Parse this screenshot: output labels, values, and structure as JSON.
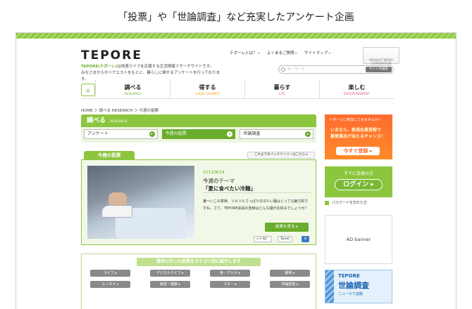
{
  "caption": "「投票」や「世論調査」など充実したアンケート企画",
  "site": {
    "logo": "TEPORE",
    "tagline_brand": "TEPORE(テポーレ)",
    "tagline_rest": "は快適ライフを応援する生活情報リサーチサイトです。",
    "tagline_line2": "みなさまからのリクエストをもとに、暮らしに関するアンケートを行っております。",
    "corp_label": "PRODUCT MEDIA CORPORATION"
  },
  "toplinks": [
    "テポーレとは？",
    "よくあるご質問",
    "サイトマップ"
  ],
  "search": {
    "placeholder": "キーワード",
    "button": "サイト内検索"
  },
  "gnav": [
    {
      "jp": "調べる",
      "en": "RESEARCH",
      "color": "#6aac2e"
    },
    {
      "jp": "得する",
      "en": "LUCKY CHANCE",
      "color": "#f39800"
    },
    {
      "jp": "暮らす",
      "en": "LIFE",
      "color": "#e85298"
    },
    {
      "jp": "楽しむ",
      "en": "ENTERTAINMENT",
      "color": "#e85298"
    }
  ],
  "breadcrumb": "HOME ＞ 調べる RESEARCH ＞ 今週の投票",
  "section": {
    "title": "調べる",
    "en": "RESEARCH"
  },
  "subtabs": [
    "アンケート",
    "今週の投票",
    "世論調査"
  ],
  "weekly": {
    "tab": "今週の投票",
    "backnumber": "これまでのバックナンバーはこちら ▸",
    "date": "2012/8/14",
    "theme_label": "今週のテーマ",
    "theme": "「夏に食べたい冷麺」",
    "desc": "暑～いこの季節、ツルツルさっぱりの冷たい麺はとっても魅力的ですね。さて、TEPORE会員の皆様はどんな麺がお好みでしょうか？",
    "result_button": "結果を見る ▸",
    "social": [
      "いいね！",
      "Tweet"
    ]
  },
  "categories": {
    "title": "過去に行った投票をカテゴリ別に紹介します",
    "items": [
      "ライフ ▸",
      "デジタルライフ ▸",
      "食・グルメ ▸",
      "趣味 ▸",
      "エンタメ ▸",
      "美容・健康 ▸",
      "マネー ▸",
      "世論調査 ▸"
    ]
  },
  "sidebar": {
    "promo_line1": "テポーレに参加してみませんか？",
    "promo_line2": "いまなら、新規会員登録で",
    "promo_line3": "豪華賞品が当たるチャンス！",
    "register_button": "今すぐ登録 ▸",
    "members_label": "すでに会員の方",
    "login_button": "ログイン ▸",
    "forgot": "パスワードを忘れた方",
    "ad": "AD banner",
    "seron_brand": "TEPORE",
    "seron_title": "世論調査",
    "seron_sub": "ニュースで話題"
  }
}
